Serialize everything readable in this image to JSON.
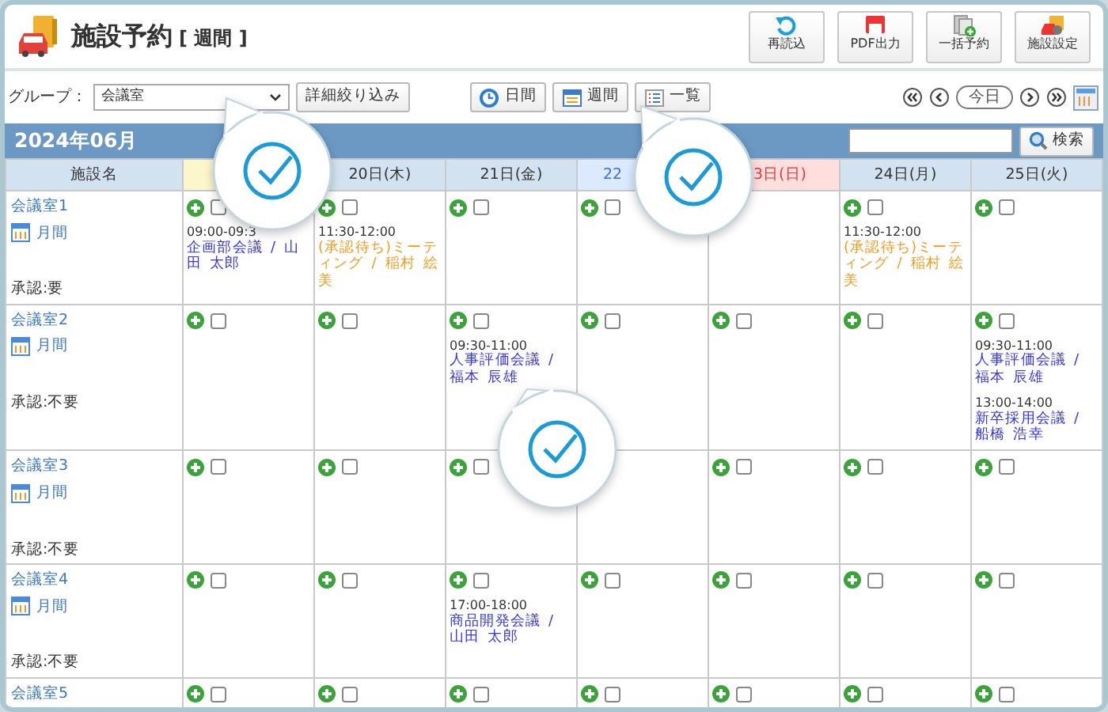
{
  "header": {
    "title": "施設予約",
    "view_label": "[ 週間 ]",
    "tools": [
      {
        "label": "再読込",
        "kind": "reload"
      },
      {
        "label": "PDF出力",
        "kind": "pdf"
      },
      {
        "label": "一括予約",
        "kind": "bulk"
      },
      {
        "label": "施設設定",
        "kind": "settings"
      }
    ]
  },
  "filter": {
    "label": "グループ：",
    "select_value": "会議室",
    "detail_button": "詳細絞り込み"
  },
  "views": [
    {
      "label": "日間",
      "kind": "day"
    },
    {
      "label": "週間",
      "kind": "week"
    },
    {
      "label": "一覧",
      "kind": "list"
    }
  ],
  "nav": {
    "today": "今日"
  },
  "month": {
    "title": "2024年06月",
    "search_button": "検索"
  },
  "columns": [
    {
      "label": "施設名",
      "kind": "name"
    },
    {
      "kind": "today"
    },
    {
      "label": "20日(木)",
      "kind": "weekday"
    },
    {
      "label": "21日(金)",
      "kind": "weekday"
    },
    {
      "label": "22",
      "kind": "saturday"
    },
    {
      "label": "3日(日)",
      "kind": "sunday"
    },
    {
      "label": "24日(月)",
      "kind": "weekday"
    },
    {
      "label": "25日(火)",
      "kind": "weekday"
    }
  ],
  "rooms": [
    {
      "name": "会議室1",
      "monthly": "月間",
      "approval": "承認:要",
      "cells": [
        {
          "checked": false,
          "events": [
            {
              "time": "09:00-09:3",
              "title": "企画部会議 / 山田 太郎",
              "pending": false
            }
          ]
        },
        {
          "checked": false,
          "events": [
            {
              "time": "11:30-12:00",
              "title": "(承認待ち)ミーティング / 稲村 絵美",
              "pending": true
            }
          ]
        },
        {
          "checked": false
        },
        {
          "checked": false
        },
        null,
        {
          "checked": false,
          "events": [
            {
              "time": "11:30-12:00",
              "title": "(承認待ち)ミーティング / 稲村 絵美",
              "pending": true
            }
          ]
        },
        {
          "checked": false
        }
      ]
    },
    {
      "name": "会議室2",
      "monthly": "月間",
      "approval": "承認:不要",
      "cells": [
        {
          "checked": false
        },
        {
          "checked": false
        },
        {
          "checked": false,
          "events": [
            {
              "time": "09:30-11:00",
              "title": "人事評価会議 / 福本 辰雄",
              "pending": false
            }
          ]
        },
        {
          "checked": false
        },
        {
          "checked": false
        },
        {
          "checked": false
        },
        {
          "checked": false,
          "events": [
            {
              "time": "09:30-11:00",
              "title": "人事評価会議 / 福本 辰雄",
              "pending": false
            },
            {
              "time": "13:00-14:00",
              "title": "新卒採用会議 / 船橋 浩幸",
              "pending": false
            }
          ]
        }
      ]
    },
    {
      "name": "会議室3",
      "monthly": "月間",
      "approval": "承認:不要",
      "cells": [
        {
          "checked": false
        },
        {
          "checked": false
        },
        {
          "checked": false
        },
        null,
        {
          "checked": false
        },
        {
          "checked": false
        },
        {
          "checked": false
        }
      ]
    },
    {
      "name": "会議室4",
      "monthly": "月間",
      "approval": "承認:不要",
      "cells": [
        {
          "checked": false
        },
        {
          "checked": false
        },
        {
          "checked": false,
          "events": [
            {
              "time": "17:00-18:00",
              "title": "商品開発会議 / 山田 太郎",
              "pending": false
            }
          ]
        },
        {
          "checked": false
        },
        {
          "checked": false
        },
        {
          "checked": false
        },
        {
          "checked": false
        }
      ]
    },
    {
      "name": "会議室5",
      "cells": [
        {
          "checked": false
        },
        {
          "checked": false
        },
        {
          "checked": false
        },
        {
          "checked": false
        },
        {
          "checked": false
        },
        {
          "checked": false
        },
        {
          "checked": false
        }
      ]
    }
  ]
}
